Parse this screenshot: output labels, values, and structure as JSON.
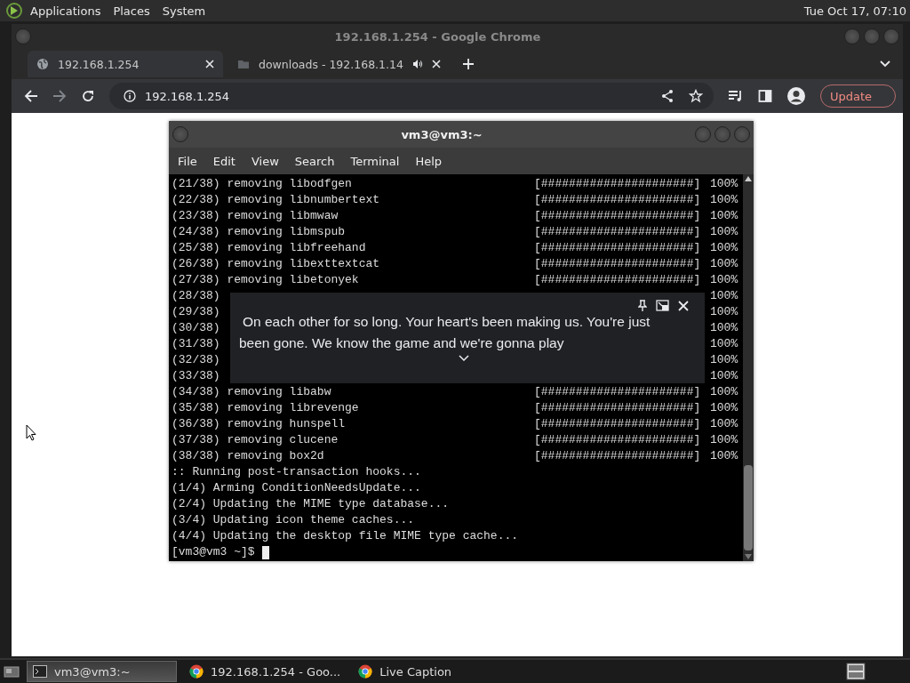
{
  "top_panel": {
    "menus": [
      "Applications",
      "Places",
      "System"
    ],
    "clock": "Tue Oct 17, 07:10"
  },
  "browser": {
    "title": "192.168.1.254 - Google Chrome",
    "tabs": [
      {
        "label": "192.168.1.254",
        "selected": true,
        "kind": "globe",
        "audio": false
      },
      {
        "label": "downloads - 192.168.1.14",
        "selected": false,
        "kind": "folder",
        "audio": true
      }
    ],
    "address": "192.168.1.254",
    "update_label": "Update"
  },
  "terminal": {
    "title": "vm3@vm3:~",
    "menus": [
      "File",
      "Edit",
      "View",
      "Search",
      "Terminal",
      "Help"
    ],
    "lines": [
      {
        "kind": "progress",
        "prefix": "(21/38)",
        "text": "removing libodfgen",
        "bar": "[######################]",
        "pct": "100%"
      },
      {
        "kind": "progress",
        "prefix": "(22/38)",
        "text": "removing libnumbertext",
        "bar": "[######################]",
        "pct": "100%"
      },
      {
        "kind": "progress",
        "prefix": "(23/38)",
        "text": "removing libmwaw",
        "bar": "[######################]",
        "pct": "100%"
      },
      {
        "kind": "progress",
        "prefix": "(24/38)",
        "text": "removing libmspub",
        "bar": "[######################]",
        "pct": "100%"
      },
      {
        "kind": "progress",
        "prefix": "(25/38)",
        "text": "removing libfreehand",
        "bar": "[######################]",
        "pct": "100%"
      },
      {
        "kind": "progress",
        "prefix": "(26/38)",
        "text": "removing libexttextcat",
        "bar": "[######################]",
        "pct": "100%"
      },
      {
        "kind": "progress",
        "prefix": "(27/38)",
        "text": "removing libetonyek",
        "bar": "[######################]",
        "pct": "100%"
      },
      {
        "kind": "covered",
        "prefix": "(28/38)",
        "pct": "100%"
      },
      {
        "kind": "covered",
        "prefix": "(29/38)",
        "pct": "100%"
      },
      {
        "kind": "covered",
        "prefix": "(30/38)",
        "pct": "100%"
      },
      {
        "kind": "covered",
        "prefix": "(31/38)",
        "pct": "100%"
      },
      {
        "kind": "covered",
        "prefix": "(32/38)",
        "pct": "100%"
      },
      {
        "kind": "covered",
        "prefix": "(33/38)",
        "pct": "100%"
      },
      {
        "kind": "progress",
        "prefix": "(34/38)",
        "text": "removing libabw",
        "bar": "[######################]",
        "pct": "100%"
      },
      {
        "kind": "progress",
        "prefix": "(35/38)",
        "text": "removing librevenge",
        "bar": "[######################]",
        "pct": "100%"
      },
      {
        "kind": "progress",
        "prefix": "(36/38)",
        "text": "removing hunspell",
        "bar": "[######################]",
        "pct": "100%"
      },
      {
        "kind": "progress",
        "prefix": "(37/38)",
        "text": "removing clucene",
        "bar": "[######################]",
        "pct": "100%"
      },
      {
        "kind": "progress",
        "prefix": "(38/38)",
        "text": "removing box2d",
        "bar": "[######################]",
        "pct": "100%"
      },
      {
        "kind": "plain",
        "text": ":: Running post-transaction hooks..."
      },
      {
        "kind": "plain",
        "text": "(1/4) Arming ConditionNeedsUpdate..."
      },
      {
        "kind": "plain",
        "text": "(2/4) Updating the MIME type database..."
      },
      {
        "kind": "plain",
        "text": "(3/4) Updating icon theme caches..."
      },
      {
        "kind": "plain",
        "text": "(4/4) Updating the desktop file MIME type cache..."
      }
    ],
    "prompt": "[vm3@vm3 ~]$"
  },
  "live_caption": {
    "lines": [
      "On each other for so long. Your heart's been making us. You're just",
      "been gone. We know the game and we're gonna play"
    ]
  },
  "taskbar": [
    {
      "label": "vm3@vm3:~",
      "kind": "terminal",
      "selected": true
    },
    {
      "label": "192.168.1.254 - Goo...",
      "kind": "chrome",
      "selected": false
    },
    {
      "label": "Live Caption",
      "kind": "chrome",
      "selected": false
    }
  ]
}
